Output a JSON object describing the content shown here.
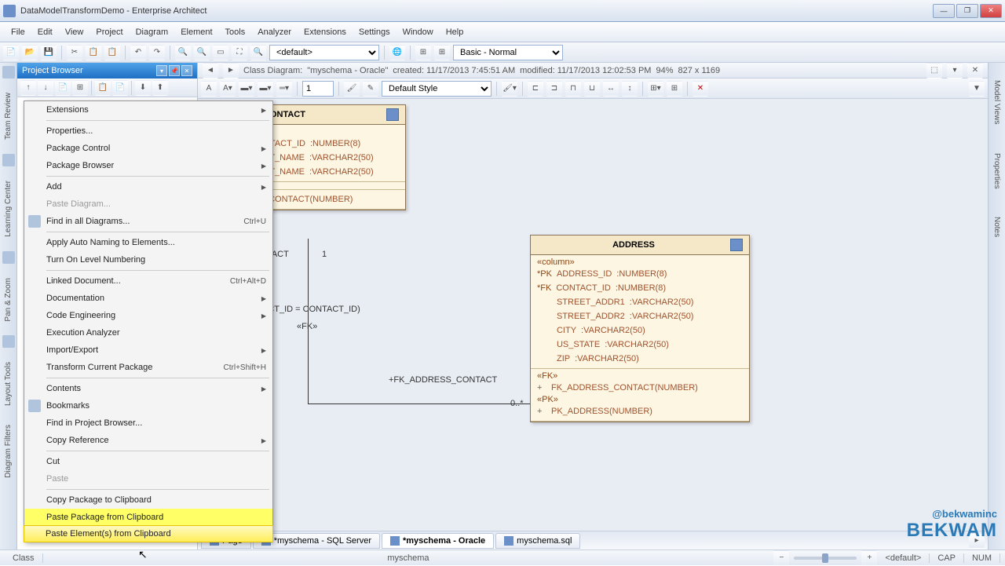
{
  "window": {
    "title": "DataModelTransformDemo - Enterprise Architect"
  },
  "menubar": [
    "File",
    "Edit",
    "View",
    "Project",
    "Diagram",
    "Element",
    "Tools",
    "Analyzer",
    "Extensions",
    "Settings",
    "Window",
    "Help"
  ],
  "toolbar": {
    "combo1": "<default>",
    "combo2": "Basic - Normal"
  },
  "browser": {
    "title": "Project Browser"
  },
  "canvas_info": {
    "type": "Class Diagram:",
    "name": "\"myschema - Oracle\"",
    "created": "created: 11/17/2013 7:45:51 AM",
    "modified": "modified: 11/17/2013 12:02:53 PM",
    "zoom": "94%",
    "size": "827 x 1169"
  },
  "canvas_tb": {
    "zoom_level": "1",
    "style": "Default Style"
  },
  "contact": {
    "title": "CONTACT",
    "stereo": "»",
    "cols": [
      {
        "prefix": "",
        "name": "NTACT_ID",
        "type": ":NUMBER(8)"
      },
      {
        "prefix": "",
        "name": "ST_NAME",
        "type": ":VARCHAR2(50)"
      },
      {
        "prefix": "",
        "name": "ST_NAME",
        "type": ":VARCHAR2(50)"
      }
    ],
    "pk": "_CONTACT(NUMBER)",
    "rel_label": "NTACT",
    "rel_card": "1"
  },
  "address": {
    "title": "ADDRESS",
    "stereo": "«column»",
    "cols": [
      {
        "prefix": "*PK",
        "name": "ADDRESS_ID",
        "type": ":NUMBER(8)"
      },
      {
        "prefix": "*FK",
        "name": "CONTACT_ID",
        "type": ":NUMBER(8)"
      },
      {
        "prefix": "",
        "name": "STREET_ADDR1",
        "type": ":VARCHAR2(50)"
      },
      {
        "prefix": "",
        "name": "STREET_ADDR2",
        "type": ":VARCHAR2(50)"
      },
      {
        "prefix": "",
        "name": "CITY",
        "type": ":VARCHAR2(50)"
      },
      {
        "prefix": "",
        "name": "US_STATE",
        "type": ":VARCHAR2(50)"
      },
      {
        "prefix": "",
        "name": "ZIP",
        "type": ":VARCHAR2(50)"
      }
    ],
    "fk_hdr": "«FK»",
    "fk_row": "FK_ADDRESS_CONTACT(NUMBER)",
    "pk_hdr": "«PK»",
    "pk_row": "PK_ADDRESS(NUMBER)"
  },
  "relation": {
    "join": "ACT_ID = CONTACT_ID)",
    "stereo": "«FK»",
    "label": "+FK_ADDRESS_CONTACT",
    "card": "0..*"
  },
  "tabs": [
    {
      "label": "Page",
      "active": false
    },
    {
      "label": "*myschema - SQL Server",
      "active": false
    },
    {
      "label": "*myschema - Oracle",
      "active": true
    },
    {
      "label": "myschema.sql",
      "active": false
    }
  ],
  "statusbar": {
    "item1": "Class",
    "center": "myschema",
    "default": "<default>"
  },
  "leftrail": [
    "Team Review",
    "Learning Center",
    "Pan & Zoom",
    "Layout Tools",
    "Diagram Filters"
  ],
  "rightrail": [
    "Model Views",
    "Properties",
    "Notes"
  ],
  "contextmenu": {
    "groups": [
      [
        {
          "label": "Extensions",
          "arrow": true
        }
      ],
      [
        {
          "label": "Properties..."
        },
        {
          "label": "Package Control",
          "arrow": true
        },
        {
          "label": "Package Browser",
          "arrow": true
        }
      ],
      [
        {
          "label": "Add",
          "arrow": true
        },
        {
          "label": "Paste Diagram...",
          "disabled": true
        },
        {
          "label": "Find in all Diagrams...",
          "shortcut": "Ctrl+U",
          "icon": true
        }
      ],
      [
        {
          "label": "Apply Auto Naming to Elements..."
        },
        {
          "label": "Turn On Level Numbering"
        }
      ],
      [
        {
          "label": "Linked Document...",
          "shortcut": "Ctrl+Alt+D"
        },
        {
          "label": "Documentation",
          "arrow": true
        },
        {
          "label": "Code Engineering",
          "arrow": true
        },
        {
          "label": "Execution Analyzer"
        },
        {
          "label": "Import/Export",
          "arrow": true
        },
        {
          "label": "Transform Current Package",
          "shortcut": "Ctrl+Shift+H"
        }
      ],
      [
        {
          "label": "Contents",
          "arrow": true
        },
        {
          "label": "Bookmarks",
          "icon": true
        },
        {
          "label": "Find in Project Browser..."
        },
        {
          "label": "Copy Reference",
          "arrow": true
        }
      ],
      [
        {
          "label": "Cut"
        },
        {
          "label": "Paste",
          "disabled": true
        }
      ],
      [
        {
          "label": "Copy Package to Clipboard"
        },
        {
          "label": "Paste Package from Clipboard",
          "hl": "yellow"
        },
        {
          "label": "Paste Element(s) from Clipboard",
          "hl": "hover"
        }
      ]
    ]
  },
  "watermark": {
    "l1": "@bekwaminc",
    "l2": "BEKWAM"
  }
}
